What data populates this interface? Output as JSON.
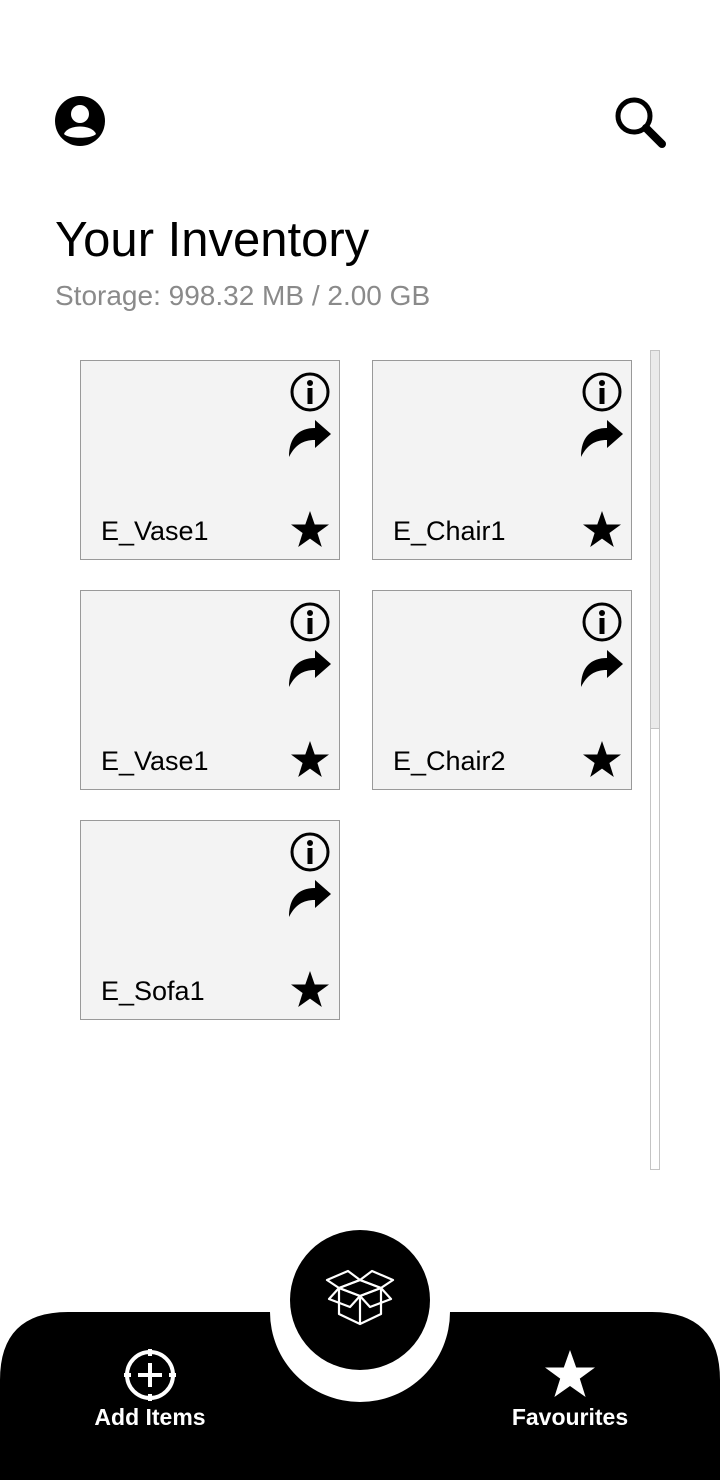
{
  "header": {
    "profile_icon": "account-circle-icon",
    "search_icon": "search-icon",
    "title": "Your Inventory",
    "storage": "Storage: 998.32 MB / 2.00 GB"
  },
  "items": [
    {
      "name": "E_Vase1"
    },
    {
      "name": "E_Chair1"
    },
    {
      "name": "E_Vase1"
    },
    {
      "name": "E_Chair2"
    },
    {
      "name": "E_Sofa1"
    }
  ],
  "item_icons": {
    "info": "info-icon",
    "share": "share-arrow-icon",
    "favourite": "star-icon"
  },
  "bottom_nav": {
    "add": {
      "label": "Add Items",
      "icon": "add-circle-icon"
    },
    "center": {
      "icon": "open-box-icon"
    },
    "favourites": {
      "label": "Favourites",
      "icon": "star-icon"
    }
  },
  "colors": {
    "accent": "#000000",
    "card_bg": "#f3f3f3",
    "muted_text": "#8a8a8a"
  }
}
